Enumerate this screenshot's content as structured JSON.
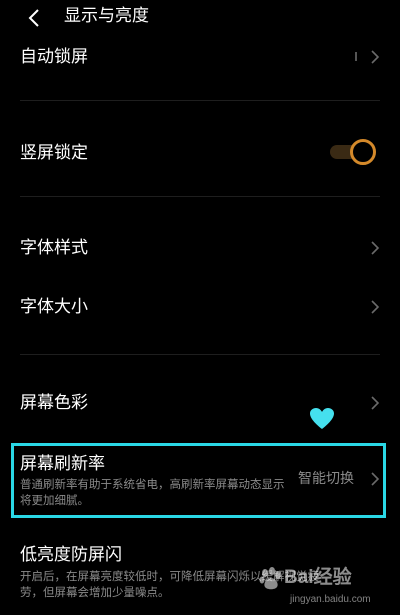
{
  "header": {
    "title": "显示与亮度",
    "back_icon": "chevron-left-icon"
  },
  "rows": {
    "auto_lock": {
      "label": "自动锁屏"
    },
    "portrait_lock": {
      "label": "竖屏锁定",
      "toggle_on": true
    },
    "font_style": {
      "label": "字体样式"
    },
    "font_size": {
      "label": "字体大小"
    },
    "screen_color": {
      "label": "屏幕色彩"
    },
    "refresh_rate": {
      "label": "屏幕刷新率",
      "description": "普通刷新率有助于系统省电，高刷新率屏幕动态显示将更加细腻。",
      "value": "智能切换"
    },
    "low_brightness_flicker": {
      "label": "低亮度防屏闪",
      "description": "开启后，在屏幕亮度较低时，可降低屏幕闪烁以缓解视觉疲劳，但屏幕会增加少量噪点。"
    }
  },
  "watermark": {
    "brand": "Bai经验",
    "url": "jingyan.baidu.com"
  },
  "colors": {
    "accent": "#d4892a",
    "highlight": "#2ad8e6",
    "heart": "#45e0ee",
    "background": "#000000",
    "secondary_text": "#8a8a8a"
  }
}
